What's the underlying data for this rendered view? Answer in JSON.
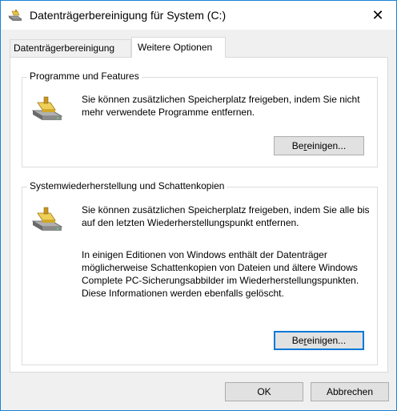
{
  "window": {
    "title": "Datenträgerbereinigung für System (C:)",
    "close_glyph": "✕"
  },
  "tabs": [
    {
      "label": "Datenträgerbereinigung",
      "selected": false
    },
    {
      "label": "Weitere Optionen",
      "selected": true
    }
  ],
  "programs_group": {
    "title": "Programme und Features",
    "description": "Sie können zusätzlichen Speicherplatz freigeben, indem Sie nicht mehr verwendete Programme entfernen.",
    "button_pre": "Be",
    "button_accel": "r",
    "button_post": "einigen..."
  },
  "restore_group": {
    "title": "Systemwiederherstellung und Schattenkopien",
    "description": "Sie können zusätzlichen Speicherplatz freigeben, indem Sie alle bis auf den letzten Wiederherstellungspunkt entfernen.",
    "note": "In einigen Editionen von Windows enthält der Datenträger möglicherweise Schattenkopien von Dateien und ältere Windows Complete PC-Sicherungsabbilder im Wiederherstellungspunkten. Diese Informationen werden ebenfalls gelöscht.",
    "button_pre": "Be",
    "button_accel": "r",
    "button_post": "einigen..."
  },
  "footer": {
    "ok_label": "OK",
    "cancel_label": "Abbrechen"
  },
  "icons": {
    "app": "disk-cleanup-icon",
    "group": "drive-cleanup-icon"
  }
}
